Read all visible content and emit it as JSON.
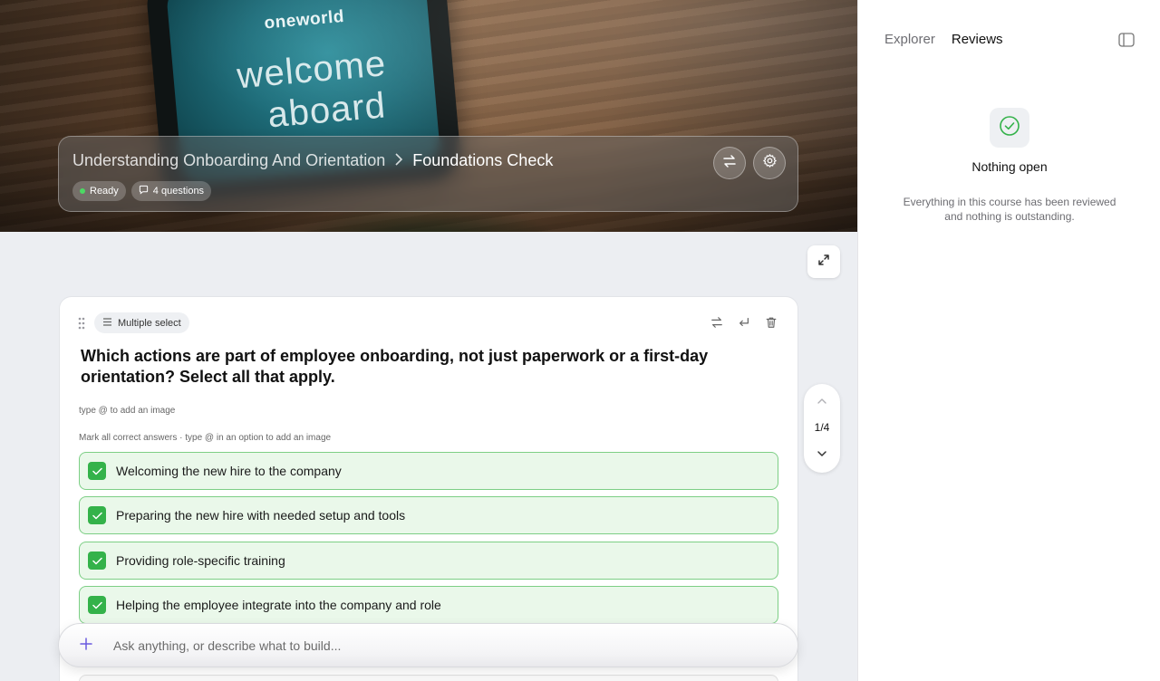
{
  "hero": {
    "phone_brand": "oneworld",
    "phone_line1": "welcome",
    "phone_line2": "aboard"
  },
  "course": {
    "breadcrumb_course": "Understanding Onboarding And Orientation",
    "breadcrumb_quiz": "Foundations Check",
    "status": "Ready",
    "question_count": "4 questions",
    "status_color": "#4cd964"
  },
  "question": {
    "type_label": "Multiple select",
    "text": "Which actions are part of employee onboarding, not just paperwork or a first-day orientation? Select all that apply.",
    "image_hint": "type @ to add an image",
    "answers_hint": "Mark all correct answers · type @ in an option to add an image",
    "options": [
      {
        "label": "Welcoming the new hire to the company",
        "checked": true
      },
      {
        "label": "Preparing the new hire with needed setup and tools",
        "checked": true
      },
      {
        "label": "Providing role-specific training",
        "checked": true
      },
      {
        "label": "Helping the employee integrate into the company and role",
        "checked": true
      }
    ]
  },
  "pager": {
    "position": "1/4"
  },
  "ask": {
    "placeholder": "Ask anything, or describe what to build..."
  },
  "sidebar": {
    "tabs": [
      "Explorer",
      "Reviews"
    ],
    "active_tab": "Reviews",
    "empty_title": "Nothing open",
    "empty_desc": "Everything in this course has been reviewed and nothing is outstanding."
  },
  "colors": {
    "accent": "#6a5adf",
    "check_green": "#34b24a",
    "option_bg": "#eaf8ea",
    "option_border": "#7dcf85"
  }
}
